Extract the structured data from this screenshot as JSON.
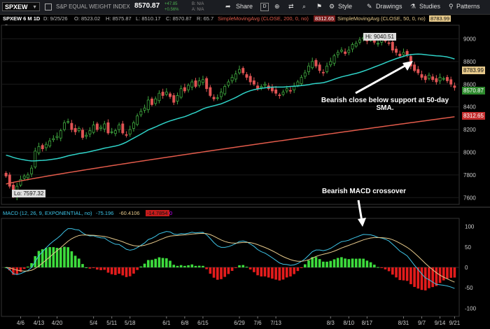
{
  "toolbar": {
    "symbol": "SPXEW",
    "name": "S&P EQUAL WEIGHT INDEX",
    "last": "8570.87",
    "change": "+47.85",
    "change_pct": "+0.56%",
    "bid": "B: N/A",
    "ask": "A: N/A",
    "period": "D",
    "share_label": "Share",
    "style_label": "Style",
    "drawings_label": "Drawings",
    "studies_label": "Studies",
    "patterns_label": "Patterns"
  },
  "legend": {
    "title": "SPXEW 6 M 1D",
    "date": "D: 9/25/26",
    "open": "O: 8523.02",
    "high": "H: 8575.87",
    "low": "L: 8510.17",
    "close": "C: 8570.87",
    "range": "R: 65.7",
    "sma200_label": "SimpleMovingAvg (CLOSE, 200, 0, no)",
    "sma200_value": "8312.65",
    "sma50_label": "SimpleMovingAvg (CLOSE, 50, 0, no)",
    "sma50_value": "8783.99"
  },
  "macd_legend": {
    "label": "MACD (12, 26, 9, EXPONENTIAL, no)",
    "value": "-75.196",
    "avg": "-60.4106",
    "diff": "-14.7854",
    "zero": "0"
  },
  "annotations": {
    "bearish_close": "Bearish close below support at 50-day SMA.",
    "bearish_macd": "Bearish MACD crossover",
    "hi_label": "Hi: 9040.51",
    "lo_label": "Lo: 7597.32"
  },
  "price_tags": {
    "sma50": "8783.99",
    "last": "8570.87",
    "sma200": "8312.65"
  },
  "colors": {
    "up": "#3fa83f",
    "down": "#e05454",
    "sma50": "#2fd3c8",
    "sma200": "#e35b4b",
    "macd": "#3ec5e8",
    "avg": "#e6c98b",
    "hist_up": "#3ddc3d",
    "hist_down": "#e31c1c"
  },
  "chart_data": [
    {
      "type": "candlestick",
      "title": "SPXEW 6 M 1D",
      "x_ticks": [
        "4/6",
        "4/13",
        "4/20",
        "5/4",
        "5/11",
        "5/18",
        "6/1",
        "6/8",
        "6/15",
        "6/29",
        "7/6",
        "7/13",
        "8/3",
        "8/10",
        "8/17",
        "8/31",
        "9/7",
        "9/14",
        "9/21"
      ],
      "y_ticks": [
        7600,
        7800,
        8000,
        8200,
        8400,
        8600,
        8800,
        9000
      ],
      "ylim": [
        7540,
        9120
      ],
      "high": 9040.51,
      "low": 7597.32,
      "close_series": [
        7790,
        7700,
        7620,
        7700,
        7760,
        7790,
        7800,
        7860,
        8010,
        8050,
        8030,
        8070,
        8100,
        8120,
        8140,
        8190,
        8260,
        8270,
        8200,
        8180,
        8210,
        8130,
        8150,
        8190,
        8240,
        8200,
        8220,
        8250,
        8170,
        8180,
        8190,
        8240,
        8170,
        8150,
        8200,
        8260,
        8320,
        8360,
        8390,
        8460,
        8420,
        8470,
        8520,
        8500,
        8530,
        8490,
        8440,
        8500,
        8560,
        8540,
        8590,
        8620,
        8580,
        8630,
        8640,
        8560,
        8500,
        8470,
        8480,
        8530,
        8580,
        8620,
        8660,
        8690,
        8730,
        8700,
        8660,
        8620,
        8600,
        8560,
        8580,
        8600,
        8560,
        8540,
        8520,
        8500,
        8530,
        8560,
        8540,
        8580,
        8620,
        8660,
        8700,
        8760,
        8800,
        8760,
        8720,
        8700,
        8760,
        8800,
        8850,
        8880,
        8900,
        8870,
        8900,
        8950,
        8960,
        8990,
        9010,
        8980,
        8990,
        8970,
        8960,
        8990,
        8980,
        8960,
        8900,
        8880,
        8850,
        8880,
        8860,
        8760,
        8720,
        8700,
        8660,
        8640,
        8680,
        8640,
        8620,
        8660,
        8650,
        8630,
        8600,
        8570.87
      ],
      "sma50": {
        "name": "SimpleMovingAvg (CLOSE, 50, 0, no)",
        "last": 8783.99
      },
      "sma200": {
        "name": "SimpleMovingAvg (CLOSE, 200, 0, no)",
        "last": 8312.65
      },
      "annotations": [
        "Bearish close below support at 50-day SMA.",
        "Hi: 9040.51",
        "Lo: 7597.32"
      ]
    },
    {
      "type": "macd",
      "title": "MACD (12, 26, 9, EXPONENTIAL, no)",
      "y_ticks": [
        100,
        50,
        0,
        -50,
        -100
      ],
      "ylim": [
        -120,
        120
      ],
      "macd_last": -75.196,
      "avg_last": -60.4106,
      "diff_last": -14.7854,
      "annotations": [
        "Bearish MACD crossover"
      ]
    }
  ]
}
